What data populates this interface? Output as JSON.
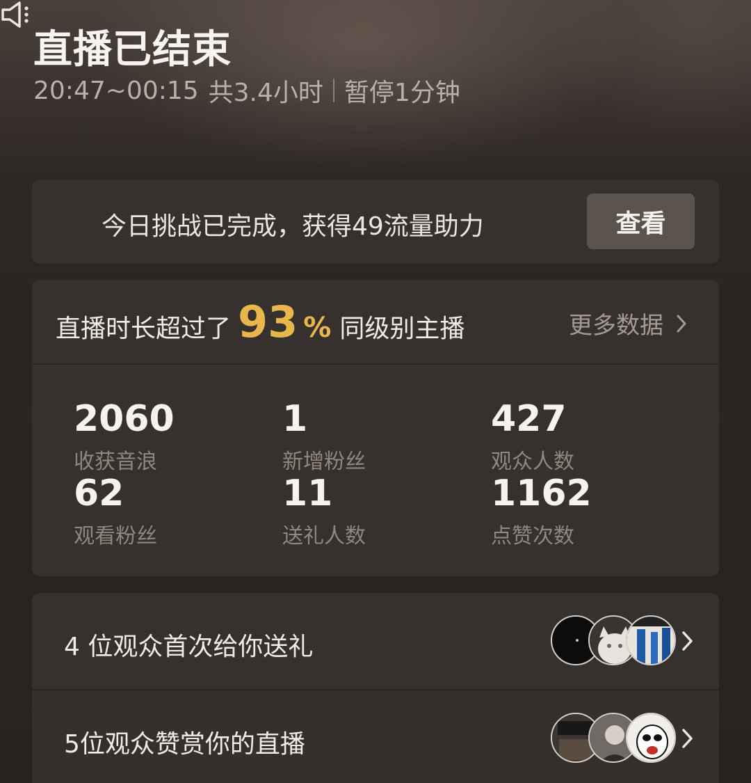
{
  "header": {
    "title": "直播已结束",
    "time_range": "20:47~00:15",
    "duration": "共3.4小时",
    "pause": "暂停1分钟"
  },
  "notice": {
    "icon": "speaker-icon",
    "text": "今日挑战已完成，获得49流量助力",
    "button_label": "查看"
  },
  "summary": {
    "prefix": "直播时长超过了",
    "percent": "93",
    "percent_sign": "%",
    "suffix": "同级别主播",
    "more_label": "更多数据"
  },
  "stats": [
    {
      "value": "2060",
      "label": "收获音浪"
    },
    {
      "value": "1",
      "label": "新增粉丝"
    },
    {
      "value": "427",
      "label": "观众人数"
    },
    {
      "value": "62",
      "label": "观看粉丝"
    },
    {
      "value": "11",
      "label": "送礼人数"
    },
    {
      "value": "1162",
      "label": "点赞次数"
    }
  ],
  "rows": [
    {
      "text": "4 位观众首次给你送礼"
    },
    {
      "text": "5位观众赞赏你的直播"
    }
  ],
  "colors": {
    "accent": "#e9b64b",
    "background": "#2a2523",
    "card": "#3a3431"
  }
}
